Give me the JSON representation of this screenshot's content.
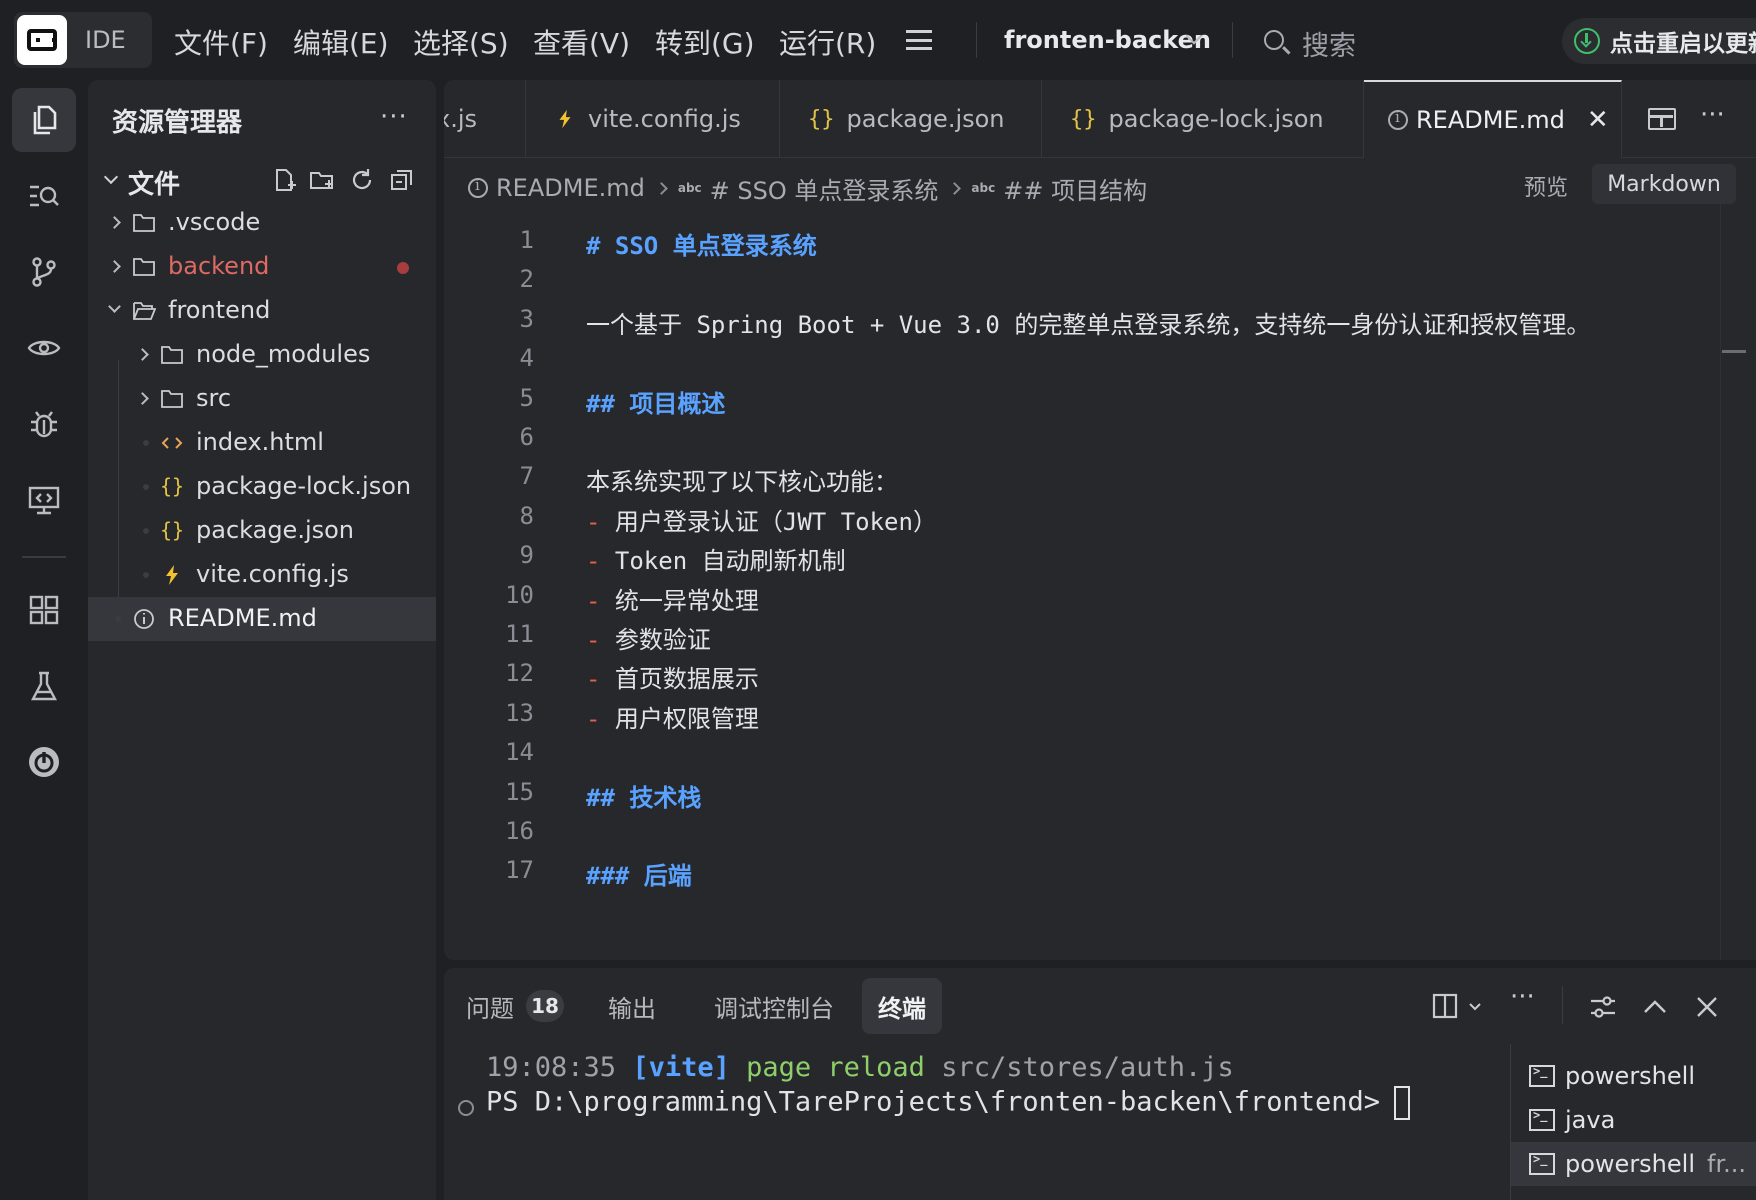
{
  "titlebar": {
    "ide_label": "IDE",
    "menus": [
      "文件(F)",
      "编辑(E)",
      "选择(S)",
      "查看(V)",
      "转到(G)",
      "运行(R)"
    ],
    "project": "fronten-backen",
    "search": "搜索",
    "restart": "点击重启以更新"
  },
  "sidebar": {
    "title": "资源管理器",
    "section": "文件",
    "tree": [
      {
        "label": ".vscode",
        "type": "folder"
      },
      {
        "label": "backend",
        "type": "folder",
        "modified": true
      },
      {
        "label": "frontend",
        "type": "folder-open"
      },
      {
        "label": "node_modules",
        "type": "folder"
      },
      {
        "label": "src",
        "type": "folder"
      },
      {
        "label": "index.html",
        "type": "html"
      },
      {
        "label": "package-lock.json",
        "type": "json"
      },
      {
        "label": "package.json",
        "type": "json"
      },
      {
        "label": "vite.config.js",
        "type": "vite"
      },
      {
        "label": "README.md",
        "type": "info",
        "selected": true
      }
    ]
  },
  "tabs": [
    {
      "label": "x.js",
      "icon": ""
    },
    {
      "label": "vite.config.js",
      "icon": "vite-icon"
    },
    {
      "label": "package.json",
      "icon": "json-icon"
    },
    {
      "label": "package-lock.json",
      "icon": "json-icon"
    },
    {
      "label": "README.md",
      "icon": "info-icon",
      "active": true
    }
  ],
  "breadcrumb": {
    "file": "README.md",
    "h1": "# SSO 单点登录系统",
    "h2": "## 项目结构"
  },
  "editor_actions": {
    "preview": "预览",
    "mode": "Markdown"
  },
  "code_lines": [
    {
      "n": "1",
      "text": "# SSO 单点登录系统",
      "kind": "h"
    },
    {
      "n": "2",
      "text": "",
      "kind": "t"
    },
    {
      "n": "3",
      "text": "一个基于 Spring Boot + Vue 3.0 的完整单点登录系统，支持统一身份认证和授权管理。",
      "kind": "t"
    },
    {
      "n": "4",
      "text": "",
      "kind": "t"
    },
    {
      "n": "5",
      "text": "## 项目概述",
      "kind": "h"
    },
    {
      "n": "6",
      "text": "",
      "kind": "t"
    },
    {
      "n": "7",
      "text": "本系统实现了以下核心功能：",
      "kind": "t"
    },
    {
      "n": "8",
      "text": "用户登录认证（JWT Token）",
      "kind": "li"
    },
    {
      "n": "9",
      "text": "Token 自动刷新机制",
      "kind": "li"
    },
    {
      "n": "10",
      "text": "统一异常处理",
      "kind": "li"
    },
    {
      "n": "11",
      "text": "参数验证",
      "kind": "li"
    },
    {
      "n": "12",
      "text": "首页数据展示",
      "kind": "li"
    },
    {
      "n": "13",
      "text": "用户权限管理",
      "kind": "li"
    },
    {
      "n": "14",
      "text": "",
      "kind": "t"
    },
    {
      "n": "15",
      "text": "## 技术栈",
      "kind": "h"
    },
    {
      "n": "16",
      "text": "",
      "kind": "t"
    },
    {
      "n": "17",
      "text": "### 后端",
      "kind": "h"
    }
  ],
  "panel": {
    "tabs": [
      "问题",
      "输出",
      "调试控制台",
      "终端"
    ],
    "problems_count": "18",
    "terminal": {
      "time": "19:08:35",
      "tag": "[vite]",
      "action": "page reload",
      "path": "src/stores/auth.js",
      "prompt": "PS D:\\programming\\TareProjects\\fronten-backen\\frontend>"
    },
    "sessions": [
      {
        "label": "powershell",
        "extra": ""
      },
      {
        "label": "java",
        "extra": ""
      },
      {
        "label": "powershell",
        "extra": "fr...",
        "active": true
      }
    ]
  },
  "colors": {
    "accent_blue": "#5aa2ff",
    "list_dash": "#e0604f",
    "modified": "#a83d40",
    "update_green": "#3fbf6a"
  }
}
